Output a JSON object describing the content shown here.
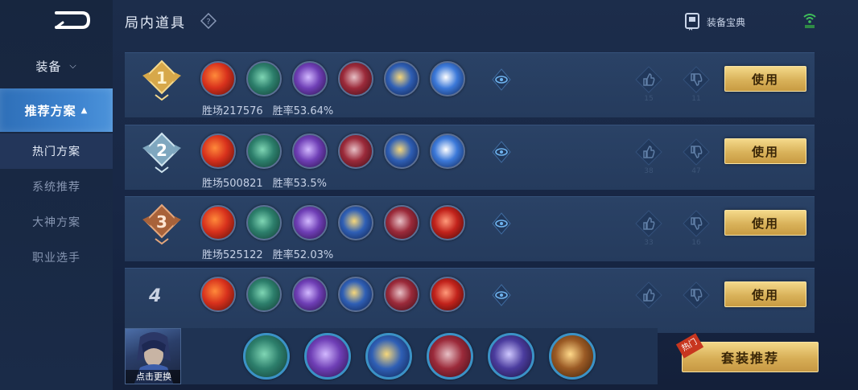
{
  "header": {
    "title": "局内道具",
    "help_icon": "question-diamond-icon",
    "codex_label": "装备宝典",
    "codex_icon": "codex-book-icon",
    "network_icon": "wifi-signal-icon"
  },
  "sidebar": {
    "back_icon": "back-arrow-icon",
    "category_label": "装备",
    "active_label": "推荐方案",
    "sub_items": [
      {
        "label": "热门方案",
        "selected": true
      },
      {
        "label": "系统推荐",
        "selected": false
      },
      {
        "label": "大神方案",
        "selected": false
      },
      {
        "label": "职业选手",
        "selected": false
      }
    ]
  },
  "rows": [
    {
      "rank": "1",
      "rank_style": "gold-medal",
      "items": [
        "red-blade",
        "green-boots",
        "purple-axe",
        "crimson-armor",
        "blue-gold-spear",
        "ice-spear"
      ],
      "wins_label": "胜场217576",
      "rate_label": "胜率53.64%",
      "likes": "15",
      "dislikes": "11",
      "use_label": "使用"
    },
    {
      "rank": "2",
      "rank_style": "silver-medal",
      "items": [
        "red-blade",
        "green-boots",
        "purple-axe",
        "crimson-armor",
        "blue-gold-spear",
        "ice-spear"
      ],
      "wins_label": "胜场500821",
      "rate_label": "胜率53.5%",
      "likes": "38",
      "dislikes": "47",
      "use_label": "使用"
    },
    {
      "rank": "3",
      "rank_style": "bronze-medal",
      "items": [
        "red-blade",
        "green-boots",
        "purple-axe",
        "blue-gold-spear",
        "crimson-armor",
        "red-helmet"
      ],
      "wins_label": "胜场525122",
      "rate_label": "胜率52.03%",
      "likes": "33",
      "dislikes": "16",
      "use_label": "使用"
    },
    {
      "rank": "4",
      "rank_style": "plain",
      "items": [
        "red-blade",
        "green-boots",
        "purple-axe",
        "blue-gold-spear",
        "crimson-armor",
        "red-helmet"
      ],
      "wins_label": "",
      "rate_label": "",
      "likes": "",
      "dislikes": "",
      "use_label": "使用"
    }
  ],
  "bottom": {
    "hero_label": "点击更换",
    "items": [
      "green-boots",
      "purple-axe",
      "blue-gold-spear",
      "crimson-armor",
      "violet-armor",
      "bronze-armor"
    ],
    "suit_label": "套装推荐",
    "hot_badge": "热门"
  },
  "colors": {
    "gold_button": "#d9b25a",
    "active_tab": "#3f85d0",
    "row_bg": "#2a4266",
    "page_bg": "#1a2a45"
  }
}
